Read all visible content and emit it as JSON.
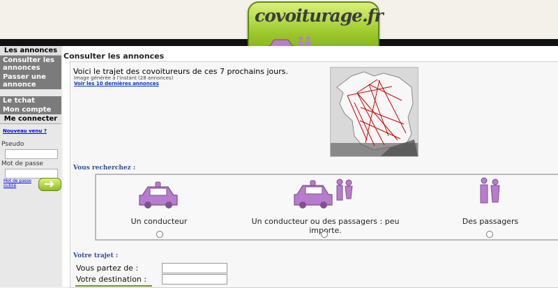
{
  "header": {
    "logo_text": "covoiturage.fr",
    "colors": {
      "band": "#111111",
      "logo_green": "#9cc82a",
      "icon_purple": "#b980c7"
    }
  },
  "sidebar": {
    "section1_title": "Les annonces",
    "links1": [
      "Consulter les annonces",
      "Passer une annonce"
    ],
    "links2": [
      "Le tchat",
      "Mon compte"
    ],
    "section2_title": "Me connecter",
    "signup_link": "Nouveau venu ?",
    "pseudo_label": "Pseudo",
    "password_label": "Mot de passe",
    "forgot_link": "Mot de passe oublié"
  },
  "main": {
    "title": "Consulter les annonces",
    "intro": "Voici le trajet des covoitureurs de ces 7 prochains jours.",
    "generated": "Image générée à l'instant (28 annonces)",
    "last_link": "Voir les 10 dernières annonces",
    "search_label": "Vous recherchez :",
    "choices": [
      "Un conducteur",
      "Un conducteur ou des passagers : peu importe.",
      "Des passagers"
    ],
    "trip_label": "Votre trajet :",
    "from_label": "Vous partez de :",
    "to_label": "Votre destination :"
  }
}
